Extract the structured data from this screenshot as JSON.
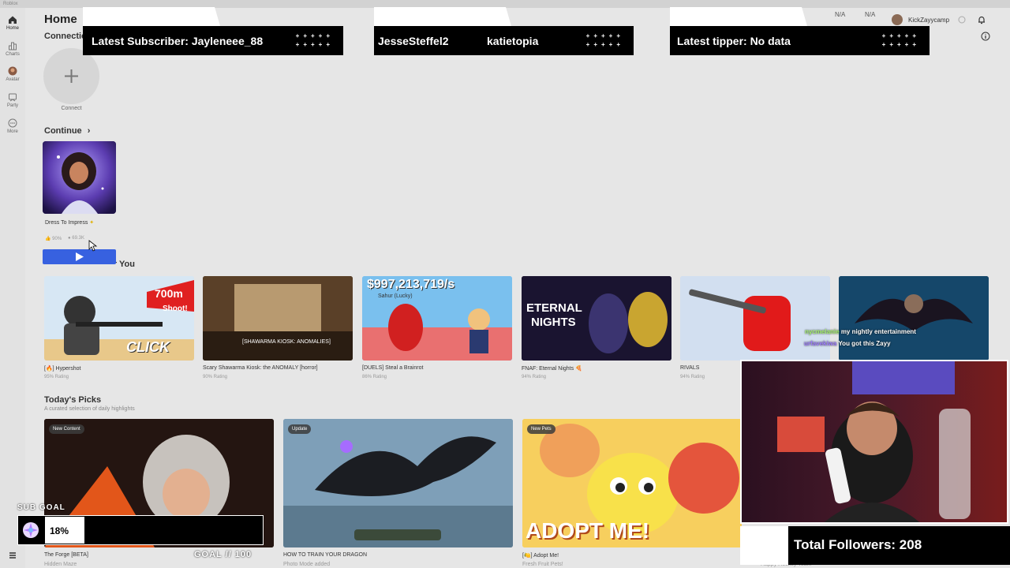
{
  "window": {
    "title": "Roblox"
  },
  "nav": {
    "items": [
      {
        "label": "Home",
        "icon": "home-icon"
      },
      {
        "label": "Charts",
        "icon": "charts-icon"
      },
      {
        "label": "Avatar",
        "icon": "avatar-icon"
      },
      {
        "label": "Party",
        "icon": "party-icon"
      },
      {
        "label": "More",
        "icon": "more-icon"
      }
    ]
  },
  "topbar": {
    "robux_a": "N/A",
    "robux_b": "N/A",
    "username": "KickZayycamp"
  },
  "page": {
    "title": "Home",
    "connections_heading": "Connections",
    "connect_label": "Connect",
    "continue_heading": "Continue",
    "recommended_heading": "Recommended For You"
  },
  "continue_card": {
    "title": "Dress To Impress",
    "rating": "90%",
    "players": "69.3K"
  },
  "recommended": [
    {
      "title": "[🔥] Hypershot",
      "rating": "95% Rating",
      "art_text": "700m",
      "art_text2": "Shoot!",
      "art_text3": "CLICK"
    },
    {
      "title": "Scary Shawarma Kiosk: the ANOMALY [horror]",
      "rating": "90% Rating",
      "art_text": "[SHAWARMA KIOSK: ANOMALIES]"
    },
    {
      "title": "[DUELS] Steal a Brainrot",
      "rating": "86% Rating",
      "art_text": "$997,213,719/s",
      "art_text2": "Sahur (Lucky)"
    },
    {
      "title": "FNAF: Eternal Nights 🍕",
      "rating": "94% Rating",
      "art_text": "ETERNAL",
      "art_text2": "NIGHTS"
    },
    {
      "title": "RIVALS",
      "rating": "94% Rating"
    },
    {
      "title": "",
      "rating": ""
    }
  ],
  "todays_picks": {
    "heading": "Today's Picks",
    "subtitle": "A curated selection of daily highlights",
    "items": [
      {
        "badge": "New Content",
        "title": "The Forge [BETA]",
        "subtitle": "Hidden Maze"
      },
      {
        "badge": "Update",
        "title": "HOW TO TRAIN YOUR DRAGON",
        "subtitle": "Photo Mode added"
      },
      {
        "badge": "New Pets",
        "title": "[🍋] Adopt Me!",
        "subtitle": "Fresh Fruit Pets!",
        "art_text": "ADOPT ME!"
      },
      {
        "badge": "",
        "title": "",
        "subtitle": "Happy Hockey Team"
      }
    ]
  },
  "stream_overlay": {
    "latest_subscriber": "Latest Subscriber: Jayleneee_88",
    "ticker_names": [
      "JesseSteffel2",
      "katietopia"
    ],
    "latest_tipper": "Latest tipper: No data",
    "total_followers": "Total Followers: 208",
    "sub_goal_title": "SUB GOAL",
    "sub_goal_percent": "18%",
    "sub_goal_fraction": 0.18,
    "goal_text": "GOAL // 100",
    "chat": [
      {
        "user": "nycmelanie",
        "message": "my nightly entertainment",
        "color": "#a4f26b"
      },
      {
        "user": "urfavekiwa",
        "message": "You got this Zayy",
        "color": "#9d7cff"
      }
    ]
  },
  "colors": {
    "play_button": "#3761e0",
    "page_background": "#e6e6e6"
  }
}
